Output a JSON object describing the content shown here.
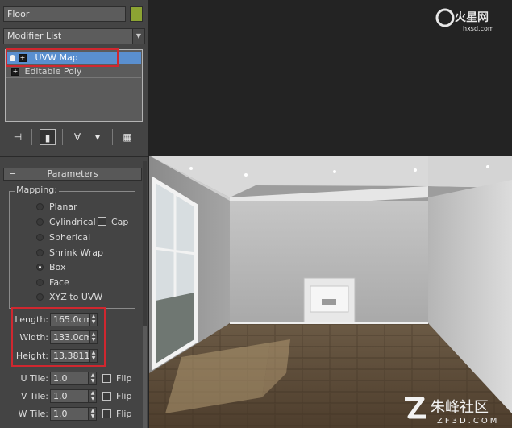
{
  "object": {
    "name": "Floor",
    "color": "#8ca433"
  },
  "modifier_list": {
    "label": "Modifier List"
  },
  "stack": {
    "items": [
      {
        "label": "UVW Map",
        "selected": true
      },
      {
        "label": "Editable Poly",
        "selected": false
      }
    ]
  },
  "stack_tools": [
    {
      "icon": "pin-stack-icon",
      "glyph": "⊣"
    },
    {
      "icon": "show-end-result-icon",
      "glyph": "▮"
    },
    {
      "icon": "make-unique-icon",
      "glyph": "∀"
    },
    {
      "icon": "remove-modifier-icon",
      "glyph": "▾"
    },
    {
      "icon": "configure-modifier-sets-icon",
      "glyph": "▦"
    }
  ],
  "parameters": {
    "title": "Parameters",
    "mapping_label": "Mapping:",
    "mapping_options": [
      {
        "label": "Planar",
        "checked": false
      },
      {
        "label": "Cylindrical",
        "checked": false
      },
      {
        "label": "Spherical",
        "checked": false
      },
      {
        "label": "Shrink Wrap",
        "checked": false
      },
      {
        "label": "Box",
        "checked": true
      },
      {
        "label": "Face",
        "checked": false
      },
      {
        "label": "XYZ to UVW",
        "checked": false
      }
    ],
    "cap_label": "Cap",
    "cap_checked": false,
    "length": {
      "label": "Length:",
      "value": "165.0cm"
    },
    "width": {
      "label": "Width:",
      "value": "133.0cm"
    },
    "height": {
      "label": "Height:",
      "value": "13.3811"
    },
    "u_tile": {
      "label": "U Tile:",
      "value": "1.0",
      "flip_label": "Flip"
    },
    "v_tile": {
      "label": "V Tile:",
      "value": "1.0",
      "flip_label": "Flip"
    },
    "w_tile": {
      "label": "W Tile:",
      "value": "1.0",
      "flip_label": "Flip"
    }
  },
  "watermarks": {
    "top_logo": "火星网",
    "top_url": "hxsd.com",
    "bottom_logo": "朱峰社区",
    "bottom_url": "ZF3D.COM"
  },
  "colors": {
    "selection": "#5a8fcf",
    "highlight_box": "#d0272f",
    "panel": "#444444"
  }
}
